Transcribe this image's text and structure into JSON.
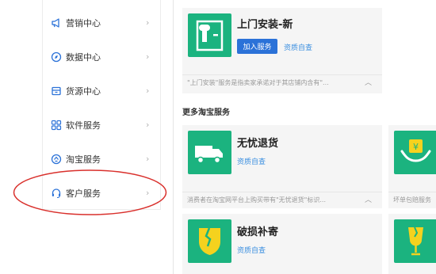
{
  "sidebar": {
    "items": [
      {
        "label": "营销中心",
        "icon": "megaphone-icon"
      },
      {
        "label": "数据中心",
        "icon": "compass-icon"
      },
      {
        "label": "货源中心",
        "icon": "box-icon"
      },
      {
        "label": "软件服务",
        "icon": "grid-icon"
      },
      {
        "label": "淘宝服务",
        "icon": "tao-icon"
      },
      {
        "label": "客户服务",
        "icon": "headset-icon"
      }
    ],
    "chevron": "›"
  },
  "featured": {
    "title": "上门安装-新",
    "join_button": "加入服务",
    "qualification_link": "资质自查",
    "description": "\"上门安装\"服务是指卖家承诺对于其店铺内含有\"...",
    "caret": "︿"
  },
  "section": {
    "title": "更多淘宝服务"
  },
  "services": [
    {
      "title": "无忧退货",
      "link": "资质自查",
      "description": "消费者在淘宝网平台上购买带有\"无忧退货\"标识...",
      "caret": "︿"
    },
    {
      "title": "",
      "link": "",
      "description": "坏单包赔服务"
    },
    {
      "title": "破损补寄",
      "link": "资质自查"
    }
  ],
  "colors": {
    "tile_green": "#1bb37f",
    "button_blue": "#2b72d8",
    "link_blue": "#3b8fe0",
    "annotation_red": "#d9302c"
  }
}
